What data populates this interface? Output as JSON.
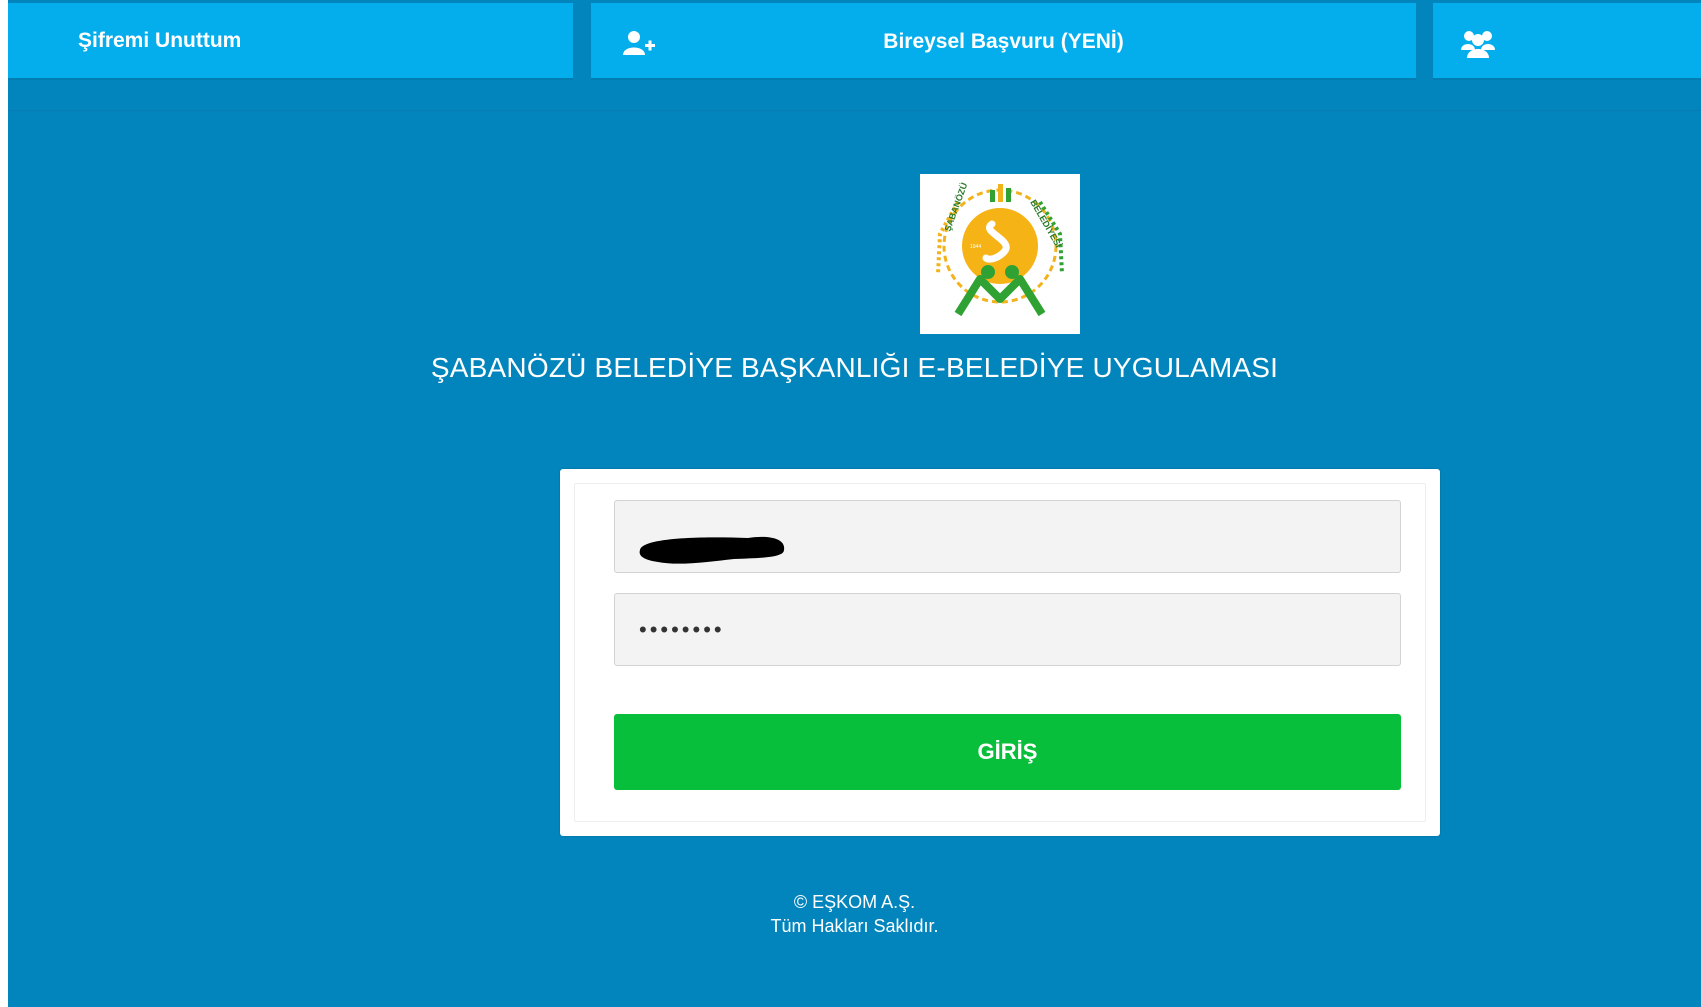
{
  "nav": {
    "forgot_password": "Şifremi Unuttum",
    "individual_application": "Bireysel Başvuru (YENİ)",
    "add_user_icon": "user-plus-icon",
    "group_icon": "users-icon"
  },
  "branding": {
    "app_title": "ŞABANÖZÜ BELEDİYE BAŞKANLIĞI E-BELEDİYE UYGULAMASI",
    "logo_text_left": "ŞABANÖZÜ",
    "logo_text_right": "BELEDİYESİ",
    "logo_year": "1944"
  },
  "login": {
    "username_value": "",
    "password_value": "••••••••",
    "submit_label": "GİRİŞ"
  },
  "footer": {
    "copyright": "© EŞKOM A.Ş.",
    "rights": "Tüm Hakları Saklıdır."
  },
  "colors": {
    "page_background": "#0285bd",
    "nav_button": "#04aeec",
    "login_button": "#08bf3b"
  }
}
